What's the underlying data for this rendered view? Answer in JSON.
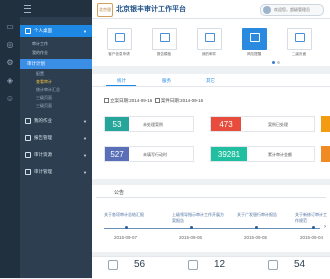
{
  "app": {
    "logo_text": "北京银丰",
    "title": "北京银丰审计工作平台",
    "user": "欢迎您，超级管理员"
  },
  "sidebar": {
    "groups": [
      {
        "label": "个人桌面",
        "active": true
      },
      {
        "label": "我的作业"
      },
      {
        "label": "报告管理"
      },
      {
        "label": "审计资源"
      },
      {
        "label": "审计管理"
      }
    ],
    "personal_items": [
      "审计工作",
      "我的作业"
    ],
    "plan_label": "审计计划",
    "plan_items": [
      "配置",
      "查看审计",
      "统计审计汇总",
      "三级页面",
      "三级页面"
    ]
  },
  "quick_actions": [
    {
      "label": "客户信息申请"
    },
    {
      "label": "报告模板"
    },
    {
      "label": "我的邮件"
    },
    {
      "label": "风险提醒"
    },
    {
      "label": "二级页面"
    }
  ],
  "stats": {
    "tabs": [
      "统计",
      "服务",
      "其它"
    ],
    "start_label": "立案日期",
    "start_date": "2014-09-16",
    "end_label": "案件日期",
    "end_date": "2014-09-16",
    "cards": [
      {
        "value": "53",
        "label": "未处理案例",
        "color": "#26a69a"
      },
      {
        "value": "473",
        "label": "案例已处理",
        "color": "#e74c3c"
      },
      {
        "value": "527",
        "label": "未填写行动时",
        "color": "#5b6fb8"
      },
      {
        "value": "39281",
        "label": "累计审计金额",
        "color": "#1fbf9f"
      }
    ]
  },
  "notices": {
    "title": "公告",
    "items": [
      {
        "text": "关于各项审计总结汇报",
        "date": "2015-09-07"
      },
      {
        "text": "上级领导指示审计工作开展方案报告",
        "date": "2015-09-06"
      },
      {
        "text": "关于广发银行审计报告",
        "date": "2015-09-05"
      },
      {
        "text": "关于新修订审计工作规范",
        "date": "2015-09-04"
      }
    ]
  },
  "bottom_stats": [
    {
      "value": "56",
      "icon": "bar-chart-icon"
    },
    {
      "value": "12",
      "icon": "pen-icon"
    },
    {
      "value": "54",
      "icon": "grid-icon"
    }
  ]
}
